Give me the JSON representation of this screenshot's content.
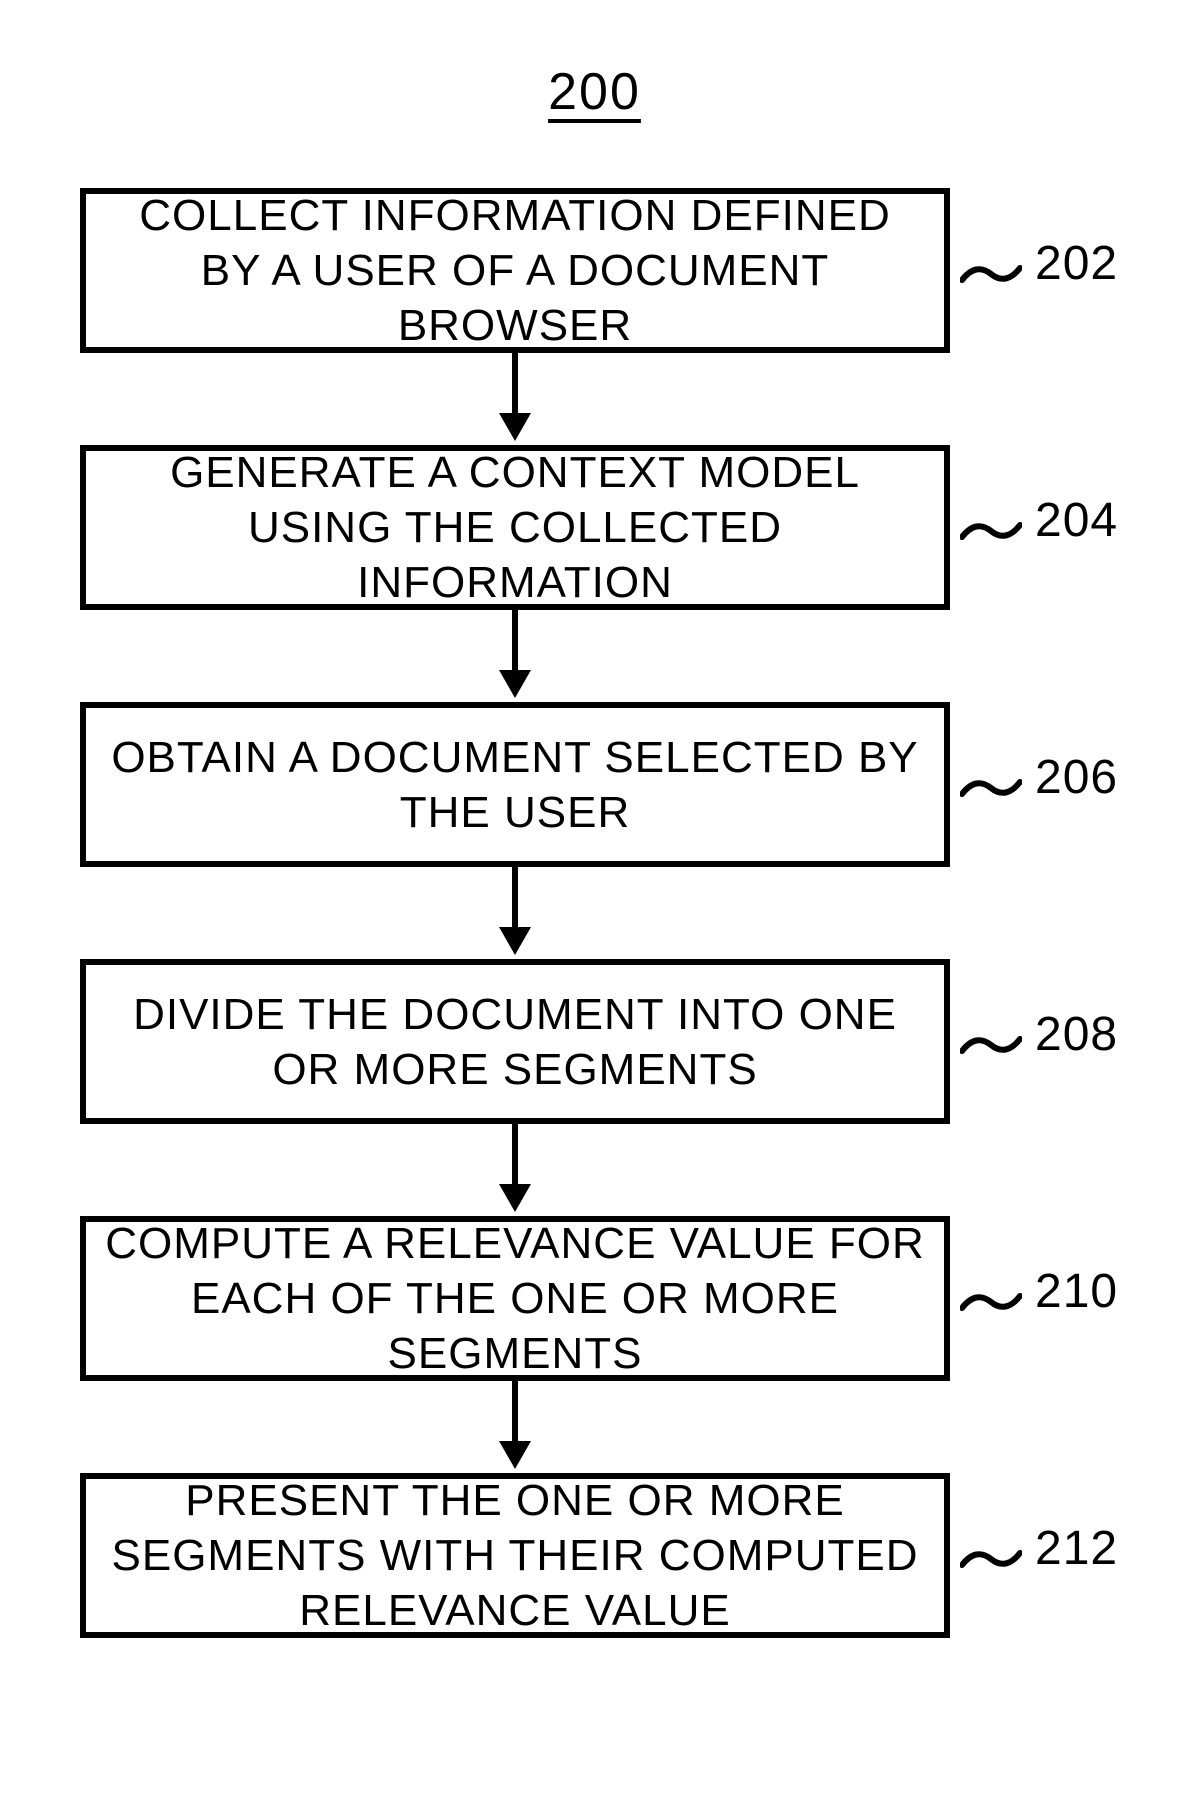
{
  "title": "200",
  "steps": [
    {
      "text": "COLLECT INFORMATION DEFINED BY A USER OF A DOCUMENT BROWSER",
      "ref": "202"
    },
    {
      "text": "GENERATE A CONTEXT MODEL USING THE COLLECTED INFORMATION",
      "ref": "204"
    },
    {
      "text": "OBTAIN A DOCUMENT SELECTED BY THE USER",
      "ref": "206"
    },
    {
      "text": "DIVIDE THE DOCUMENT INTO ONE OR MORE SEGMENTS",
      "ref": "208"
    },
    {
      "text": "COMPUTE A RELEVANCE VALUE FOR EACH OF THE ONE OR MORE SEGMENTS",
      "ref": "210"
    },
    {
      "text": "PRESENT THE ONE OR MORE SEGMENTS WITH THEIR COMPUTED RELEVANCE VALUE",
      "ref": "212"
    }
  ]
}
